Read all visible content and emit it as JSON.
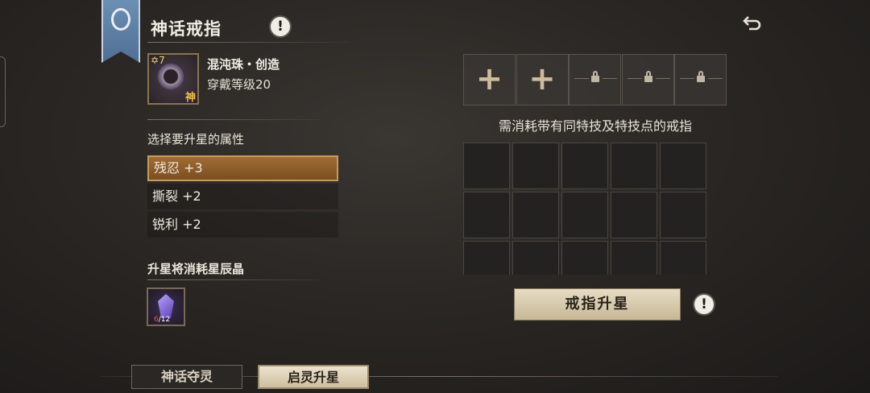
{
  "header": {
    "title": "神话戒指",
    "info_icon": "!",
    "back_icon": "back-arrow-icon"
  },
  "ring": {
    "star_level": "7",
    "name": "混沌珠・创造",
    "level_req": "穿戴等级20",
    "grade": "神"
  },
  "attributes": {
    "section_title": "选择要升星的属性",
    "items": [
      {
        "label": "残忍 +3",
        "selected": true
      },
      {
        "label": "撕裂 +2",
        "selected": false
      },
      {
        "label": "锐利 +2",
        "selected": false
      }
    ]
  },
  "consume": {
    "title": "升星将消耗星辰晶",
    "owned": "6",
    "required": "12"
  },
  "material_slots": [
    "plus",
    "plus",
    "lock",
    "lock",
    "lock"
  ],
  "requirement_text": "需消耗带有同特技及特技点的戒指",
  "upgrade_button": "戒指升星",
  "tabs": [
    {
      "label": "神话夺灵",
      "active": false
    },
    {
      "label": "启灵升星",
      "active": true
    }
  ]
}
